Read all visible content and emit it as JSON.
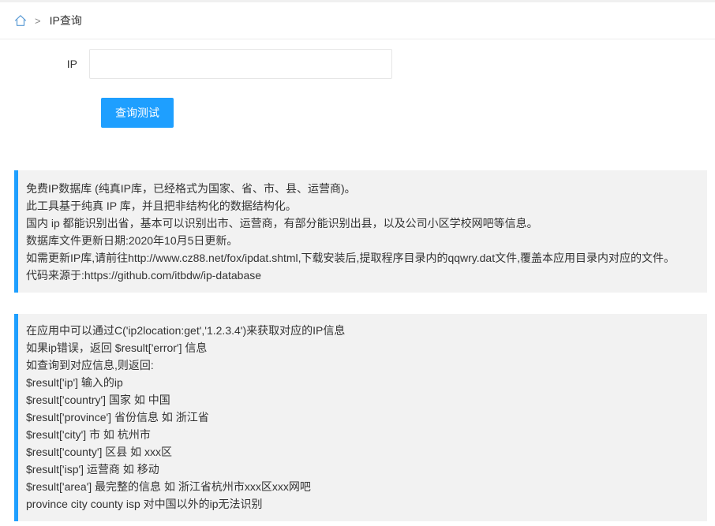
{
  "breadcrumb": {
    "separator": ">",
    "current": "IP查询"
  },
  "form": {
    "ip_label": "IP",
    "ip_value": "",
    "ip_placeholder": "",
    "submit_label": "查询测试"
  },
  "info_block": {
    "lines": [
      "免费IP数据库 (纯真IP库，已经格式为国家、省、市、县、运营商)。",
      "此工具基于纯真 IP 库，并且把非结构化的数据结构化。",
      "国内 ip 都能识别出省，基本可以识别出市、运营商，有部分能识别出县，以及公司小区学校网吧等信息。",
      "数据库文件更新日期:2020年10月5日更新。",
      "如需更新IP库,请前往http://www.cz88.net/fox/ipdat.shtml,下载安装后,提取程序目录内的qqwry.dat文件,覆盖本应用目录内对应的文件。",
      "代码来源于:https://github.com/itbdw/ip-database"
    ]
  },
  "usage_block": {
    "lines": [
      "在应用中可以通过C('ip2location:get','1.2.3.4')来获取对应的IP信息",
      "如果ip错误，返回 $result['error'] 信息",
      "如查询到对应信息,则返回:",
      "$result['ip'] 输入的ip",
      "$result['country'] 国家 如 中国",
      "$result['province'] 省份信息 如 浙江省",
      "$result['city'] 市 如 杭州市",
      "$result['county'] 区县 如 xxx区",
      "$result['isp'] 运营商 如 移动",
      "$result['area'] 最完整的信息 如 浙江省杭州市xxx区xxx网吧",
      "province city county isp 对中国以外的ip无法识别"
    ]
  },
  "colors": {
    "accent": "#1e9fff",
    "quote_bg": "#f2f2f2"
  },
  "icons": {
    "home": "home-icon"
  }
}
